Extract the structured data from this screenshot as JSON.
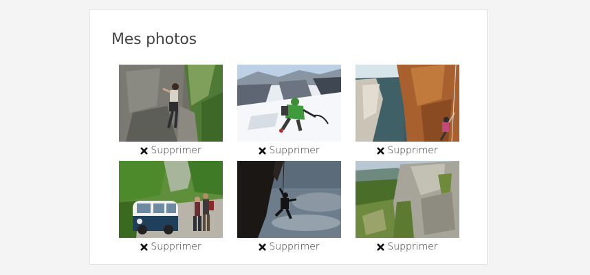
{
  "section": {
    "title": "Mes photos"
  },
  "photos": [
    {
      "scene": "rock-climber-on-wall-icon",
      "remove_label": "Supprimer"
    },
    {
      "scene": "ice-climber-in-snow-icon",
      "remove_label": "Supprimer"
    },
    {
      "scene": "cliff-above-sea-climber-icon",
      "remove_label": "Supprimer"
    },
    {
      "scene": "van-with-two-people-icon",
      "remove_label": "Supprimer"
    },
    {
      "scene": "climber-silhouette-overhang-icon",
      "remove_label": "Supprimer"
    },
    {
      "scene": "limestone-cliff-valley-icon",
      "remove_label": "Supprimer"
    }
  ],
  "colors": {
    "background": "#f4f4f4",
    "card": "#ffffff",
    "title": "#444444",
    "text": "#333333"
  }
}
